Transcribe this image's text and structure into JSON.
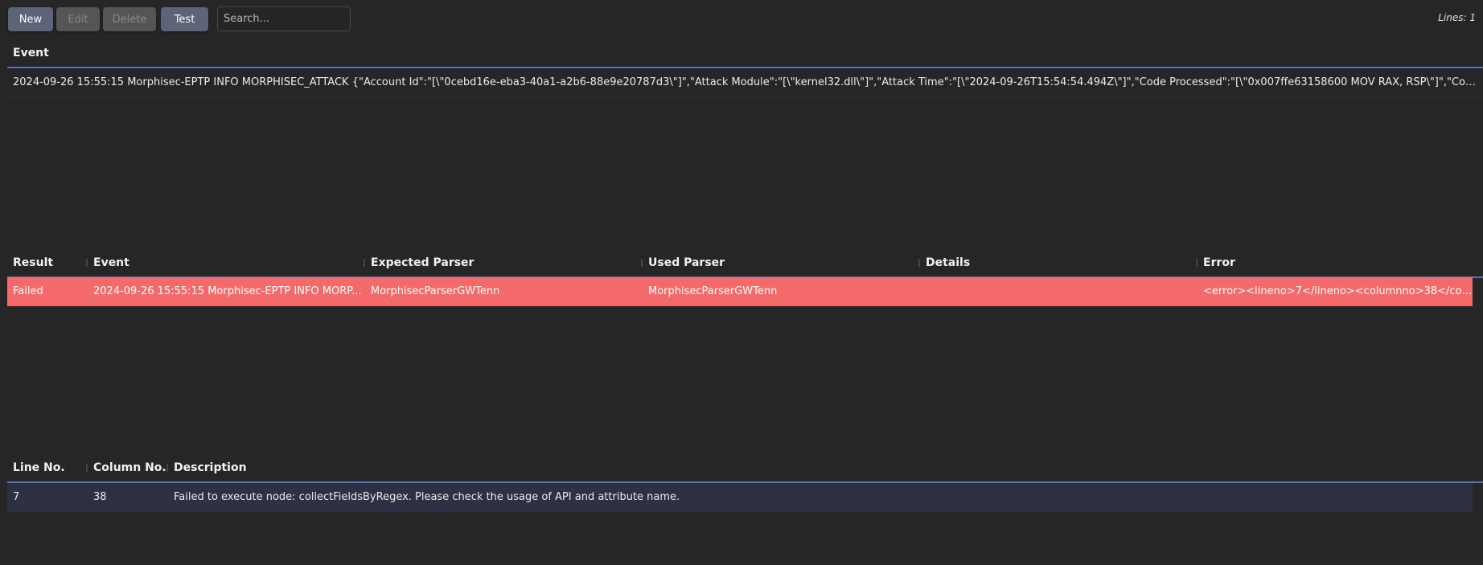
{
  "toolbar": {
    "new_label": "New",
    "edit_label": "Edit",
    "delete_label": "Delete",
    "test_label": "Test",
    "search_placeholder": "Search...",
    "lines_label": "Lines: 1"
  },
  "events_table": {
    "header": "Event",
    "rows": [
      {
        "event": "2024-09-26 15:55:15 Morphisec-EPTP INFO MORPHISEC_ATTACK {\"Account Id\":\"[\\\"0cebd16e-eba3-40a1-a2b6-88e9e20787d3\\\"]\",\"Attack Module\":\"[\\\"kernel32.dll\\\"]\",\"Attack Time\":\"[\\\"2024-09-26T15:54:54.494Z\\\"]\",\"Code Processed\":\"[\\\"0x007ffe63158600 MOV RAX, RSP\\\"]\",\"Command..."
      }
    ]
  },
  "results_table": {
    "headers": {
      "result": "Result",
      "event": "Event",
      "expected_parser": "Expected Parser",
      "used_parser": "Used Parser",
      "details": "Details",
      "error": "Error"
    },
    "rows": [
      {
        "result": "Failed",
        "event": "2024-09-26 15:55:15 Morphisec-EPTP INFO MORP...",
        "expected_parser": "MorphisecParserGWTenn",
        "used_parser": "MorphisecParserGWTenn",
        "details": "",
        "error": "<error><lineno>7</lineno><columnno>38</column...",
        "status_color": "#f46a6a"
      }
    ]
  },
  "errors_table": {
    "headers": {
      "line_no": "Line No.",
      "column_no": "Column No.",
      "description": "Description"
    },
    "rows": [
      {
        "line_no": "7",
        "column_no": "38",
        "description": "Failed to execute node: collectFieldsByRegex. Please check the usage of API and attribute name."
      }
    ]
  },
  "colors": {
    "background": "#262626",
    "accent_line": "#5a71b8",
    "failed_row": "#f46a6a",
    "selected_row": "#2d3142",
    "button": "#5b6478",
    "button_disabled": "#555555"
  }
}
